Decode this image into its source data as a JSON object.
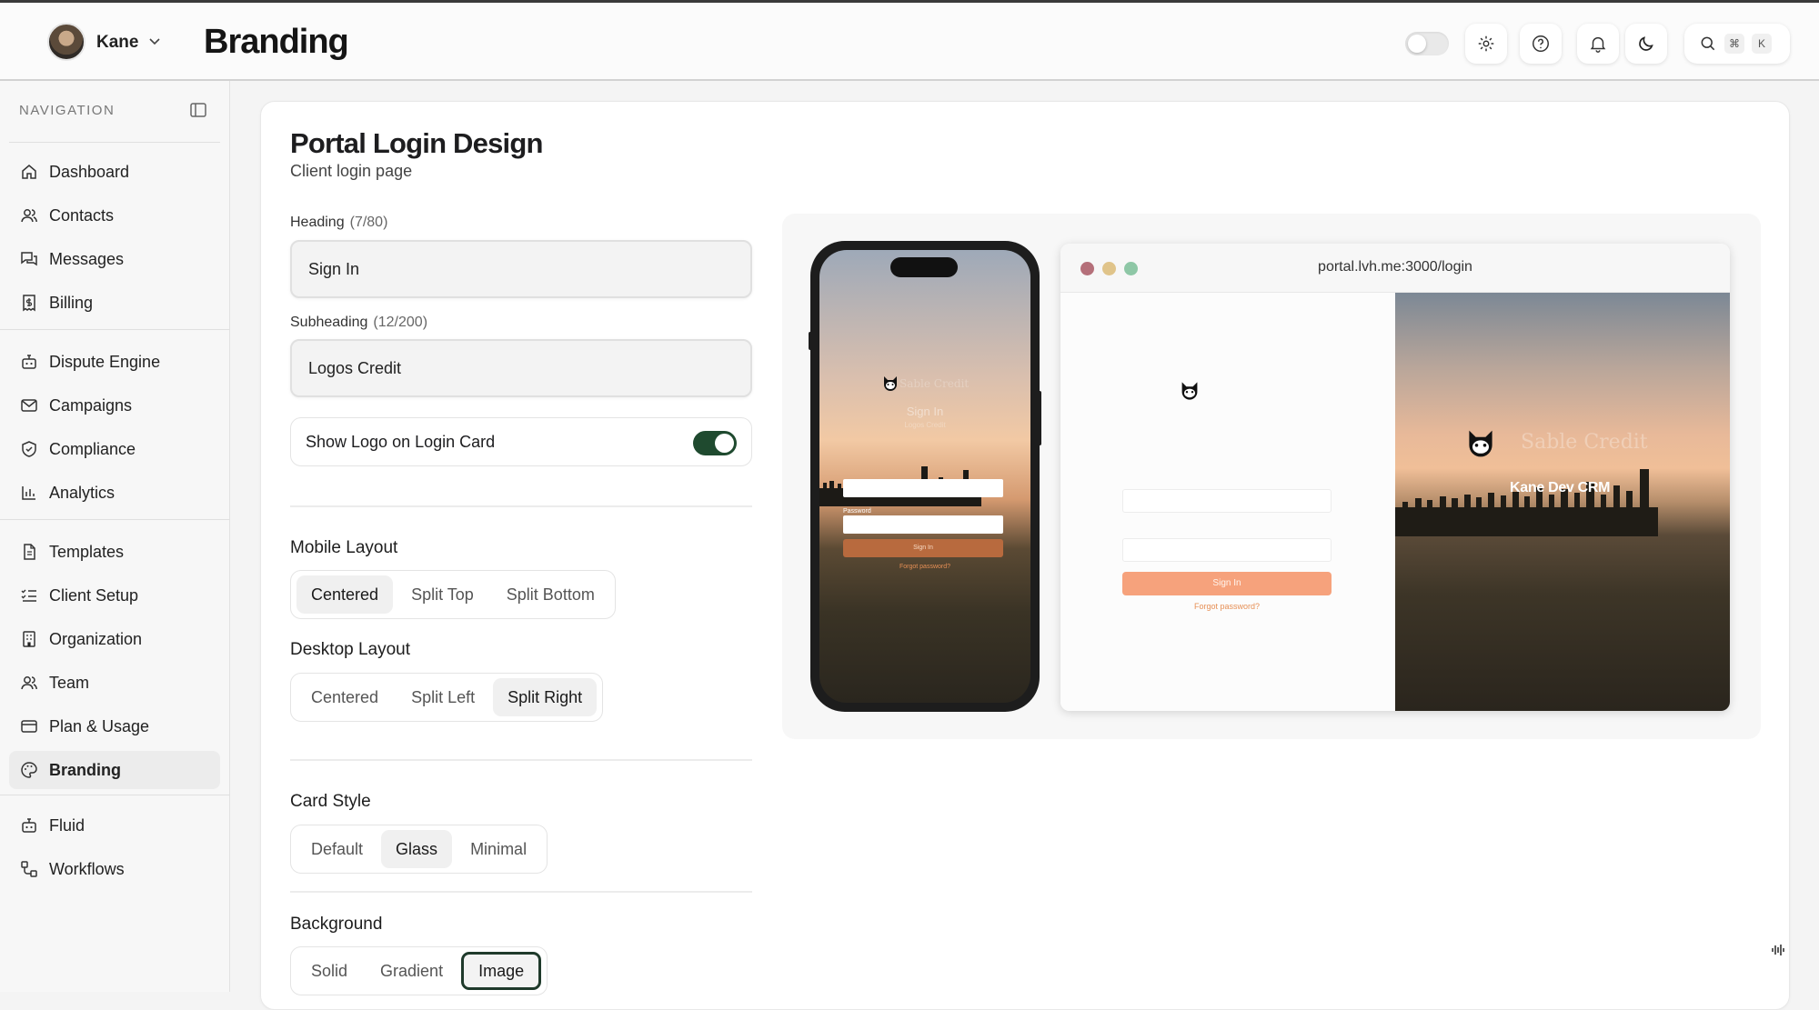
{
  "header": {
    "user_name": "Kane",
    "page_title": "Branding",
    "search_kbd_cmd": "⌘",
    "search_kbd_key": "K"
  },
  "sidebar": {
    "heading": "NAVIGATION",
    "groups": [
      [
        {
          "label": "Dashboard",
          "icon": "home-icon"
        },
        {
          "label": "Contacts",
          "icon": "users-icon"
        },
        {
          "label": "Messages",
          "icon": "messages-icon"
        },
        {
          "label": "Billing",
          "icon": "receipt-icon"
        }
      ],
      [
        {
          "label": "Dispute Engine",
          "icon": "bot-icon"
        },
        {
          "label": "Campaigns",
          "icon": "mail-icon"
        },
        {
          "label": "Compliance",
          "icon": "shield-icon"
        },
        {
          "label": "Analytics",
          "icon": "bar-chart-icon"
        }
      ],
      [
        {
          "label": "Templates",
          "icon": "file-icon"
        },
        {
          "label": "Client Setup",
          "icon": "checklist-icon"
        },
        {
          "label": "Organization",
          "icon": "building-icon"
        },
        {
          "label": "Team",
          "icon": "team-icon"
        },
        {
          "label": "Plan & Usage",
          "icon": "credit-card-icon"
        },
        {
          "label": "Branding",
          "icon": "palette-icon",
          "active": true
        }
      ],
      [
        {
          "label": "Fluid",
          "icon": "bot-icon"
        },
        {
          "label": "Workflows",
          "icon": "workflow-icon"
        }
      ]
    ]
  },
  "main": {
    "title": "Portal Login Design",
    "subtitle": "Client login page",
    "heading_field": {
      "label": "Heading",
      "count": "(7/80)",
      "value": "Sign In"
    },
    "subheading_field": {
      "label": "Subheading",
      "count": "(12/200)",
      "value": "Logos Credit"
    },
    "show_logo": {
      "label": "Show Logo on Login Card",
      "enabled": true
    },
    "mobile_layout": {
      "label": "Mobile Layout",
      "options": [
        "Centered",
        "Split Top",
        "Split Bottom"
      ],
      "selected": "Centered"
    },
    "desktop_layout": {
      "label": "Desktop Layout",
      "options": [
        "Centered",
        "Split Left",
        "Split Right"
      ],
      "selected": "Split Right"
    },
    "card_style": {
      "label": "Card Style",
      "options": [
        "Default",
        "Glass",
        "Minimal"
      ],
      "selected": "Glass"
    },
    "background": {
      "label": "Background",
      "options": [
        "Solid",
        "Gradient",
        "Image"
      ],
      "selected": "Image"
    }
  },
  "preview": {
    "url": "portal.lvh.me:3000/login",
    "phone": {
      "brand": "Sable Credit",
      "title": "Sign In",
      "subtitle": "Logos Credit",
      "password_label": "Password",
      "button": "Sign In",
      "forgot": "Forgot password?"
    },
    "desktop": {
      "button": "Sign In",
      "forgot": "Forgot password?",
      "brand": "Sable Credit",
      "crm_name": "Kane Dev CRM"
    }
  },
  "colors": {
    "toggle_on": "#1f4a2f",
    "accent_button": "#f6a27c",
    "forgot_link": "#e68f55"
  }
}
